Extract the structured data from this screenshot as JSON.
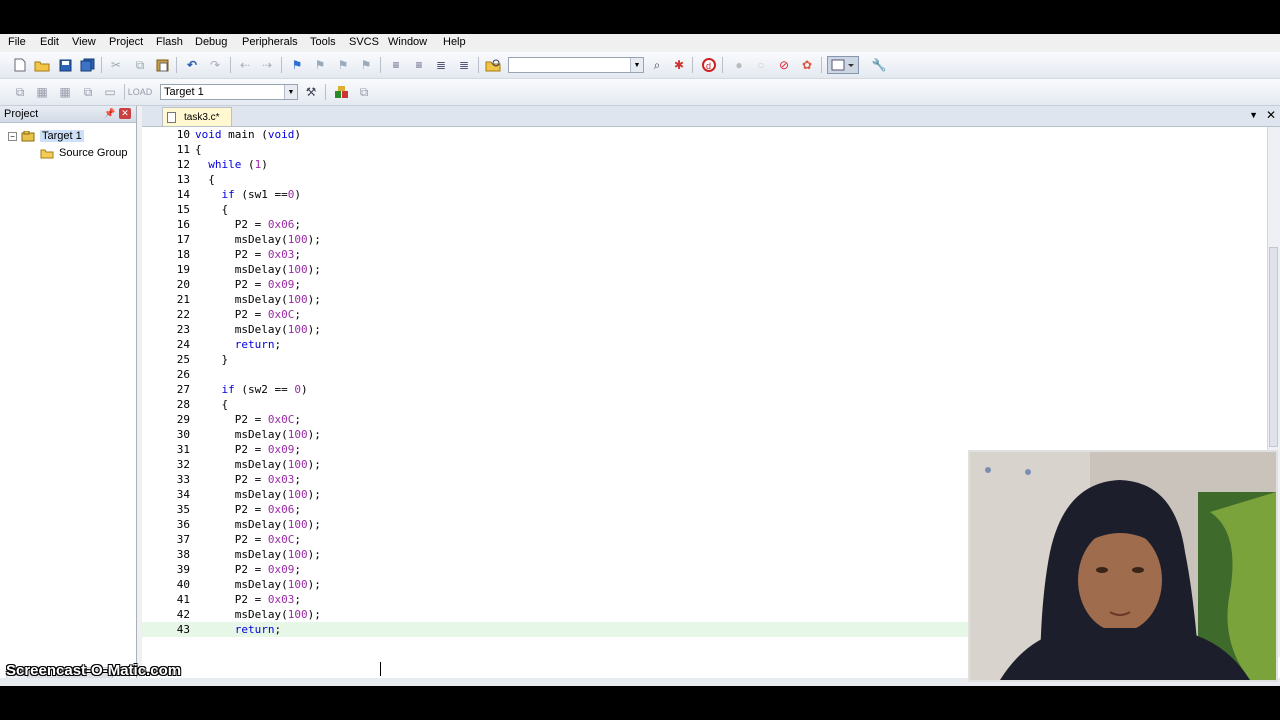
{
  "menu": [
    "File",
    "Edit",
    "View",
    "Project",
    "Flash",
    "Debug",
    "Peripherals",
    "Tools",
    "SVCS",
    "Window",
    "Help"
  ],
  "toolbar2": {
    "target_select": "Target 1"
  },
  "project_panel": {
    "title": "Project",
    "tree": [
      {
        "label": "Target 1",
        "expander": "−"
      },
      {
        "label": "Source Group"
      }
    ]
  },
  "editor": {
    "active_tab": "task3.c*",
    "lines": [
      {
        "n": "10",
        "code": "void main (void)"
      },
      {
        "n": "11",
        "code": "{"
      },
      {
        "n": "12",
        "code": "  while (1)"
      },
      {
        "n": "13",
        "code": "  {"
      },
      {
        "n": "14",
        "code": "    if (sw1 ==0)"
      },
      {
        "n": "15",
        "code": "    {"
      },
      {
        "n": "16",
        "code": "      P2 = 0x06;"
      },
      {
        "n": "17",
        "code": "      msDelay(100);"
      },
      {
        "n": "18",
        "code": "      P2 = 0x03;"
      },
      {
        "n": "19",
        "code": "      msDelay(100);"
      },
      {
        "n": "20",
        "code": "      P2 = 0x09;"
      },
      {
        "n": "21",
        "code": "      msDelay(100);"
      },
      {
        "n": "22",
        "code": "      P2 = 0x0C;"
      },
      {
        "n": "23",
        "code": "      msDelay(100);"
      },
      {
        "n": "24",
        "code": "      return;"
      },
      {
        "n": "25",
        "code": "    }"
      },
      {
        "n": "26",
        "code": ""
      },
      {
        "n": "27",
        "code": "    if (sw2 == 0)"
      },
      {
        "n": "28",
        "code": "    {"
      },
      {
        "n": "29",
        "code": "      P2 = 0x0C;"
      },
      {
        "n": "30",
        "code": "      msDelay(100);"
      },
      {
        "n": "31",
        "code": "      P2 = 0x09;"
      },
      {
        "n": "32",
        "code": "      msDelay(100);"
      },
      {
        "n": "33",
        "code": "      P2 = 0x03;"
      },
      {
        "n": "34",
        "code": "      msDelay(100);"
      },
      {
        "n": "35",
        "code": "      P2 = 0x06;"
      },
      {
        "n": "36",
        "code": "      msDelay(100);"
      },
      {
        "n": "37",
        "code": "      P2 = 0x0C;"
      },
      {
        "n": "38",
        "code": "      msDelay(100);"
      },
      {
        "n": "39",
        "code": "      P2 = 0x09;"
      },
      {
        "n": "40",
        "code": "      msDelay(100);"
      },
      {
        "n": "41",
        "code": "      P2 = 0x03;"
      },
      {
        "n": "42",
        "code": "      msDelay(100);"
      },
      {
        "n": "43",
        "code": "      return;",
        "current": true
      }
    ]
  },
  "watermark": "Screencast-O-Matic.com",
  "colors": {
    "keyword": "#0000e0",
    "number": "#9a2aa6",
    "current_line": "#e7f7e7"
  }
}
